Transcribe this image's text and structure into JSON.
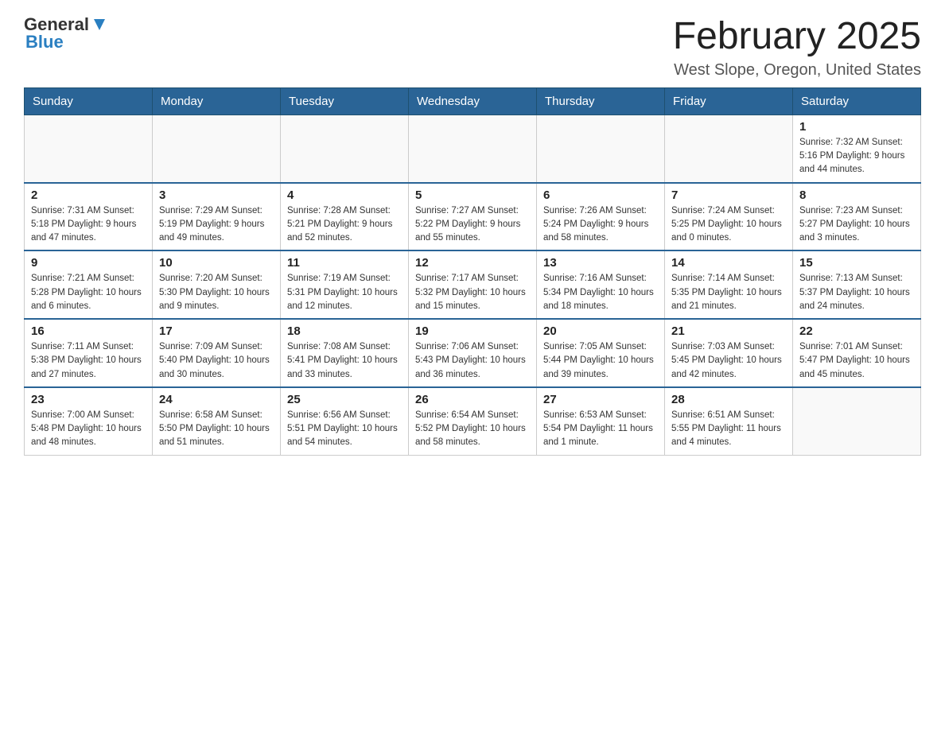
{
  "logo": {
    "general": "General",
    "blue": "Blue"
  },
  "title": "February 2025",
  "location": "West Slope, Oregon, United States",
  "days_of_week": [
    "Sunday",
    "Monday",
    "Tuesday",
    "Wednesday",
    "Thursday",
    "Friday",
    "Saturday"
  ],
  "weeks": [
    [
      {
        "day": "",
        "info": ""
      },
      {
        "day": "",
        "info": ""
      },
      {
        "day": "",
        "info": ""
      },
      {
        "day": "",
        "info": ""
      },
      {
        "day": "",
        "info": ""
      },
      {
        "day": "",
        "info": ""
      },
      {
        "day": "1",
        "info": "Sunrise: 7:32 AM\nSunset: 5:16 PM\nDaylight: 9 hours and 44 minutes."
      }
    ],
    [
      {
        "day": "2",
        "info": "Sunrise: 7:31 AM\nSunset: 5:18 PM\nDaylight: 9 hours and 47 minutes."
      },
      {
        "day": "3",
        "info": "Sunrise: 7:29 AM\nSunset: 5:19 PM\nDaylight: 9 hours and 49 minutes."
      },
      {
        "day": "4",
        "info": "Sunrise: 7:28 AM\nSunset: 5:21 PM\nDaylight: 9 hours and 52 minutes."
      },
      {
        "day": "5",
        "info": "Sunrise: 7:27 AM\nSunset: 5:22 PM\nDaylight: 9 hours and 55 minutes."
      },
      {
        "day": "6",
        "info": "Sunrise: 7:26 AM\nSunset: 5:24 PM\nDaylight: 9 hours and 58 minutes."
      },
      {
        "day": "7",
        "info": "Sunrise: 7:24 AM\nSunset: 5:25 PM\nDaylight: 10 hours and 0 minutes."
      },
      {
        "day": "8",
        "info": "Sunrise: 7:23 AM\nSunset: 5:27 PM\nDaylight: 10 hours and 3 minutes."
      }
    ],
    [
      {
        "day": "9",
        "info": "Sunrise: 7:21 AM\nSunset: 5:28 PM\nDaylight: 10 hours and 6 minutes."
      },
      {
        "day": "10",
        "info": "Sunrise: 7:20 AM\nSunset: 5:30 PM\nDaylight: 10 hours and 9 minutes."
      },
      {
        "day": "11",
        "info": "Sunrise: 7:19 AM\nSunset: 5:31 PM\nDaylight: 10 hours and 12 minutes."
      },
      {
        "day": "12",
        "info": "Sunrise: 7:17 AM\nSunset: 5:32 PM\nDaylight: 10 hours and 15 minutes."
      },
      {
        "day": "13",
        "info": "Sunrise: 7:16 AM\nSunset: 5:34 PM\nDaylight: 10 hours and 18 minutes."
      },
      {
        "day": "14",
        "info": "Sunrise: 7:14 AM\nSunset: 5:35 PM\nDaylight: 10 hours and 21 minutes."
      },
      {
        "day": "15",
        "info": "Sunrise: 7:13 AM\nSunset: 5:37 PM\nDaylight: 10 hours and 24 minutes."
      }
    ],
    [
      {
        "day": "16",
        "info": "Sunrise: 7:11 AM\nSunset: 5:38 PM\nDaylight: 10 hours and 27 minutes."
      },
      {
        "day": "17",
        "info": "Sunrise: 7:09 AM\nSunset: 5:40 PM\nDaylight: 10 hours and 30 minutes."
      },
      {
        "day": "18",
        "info": "Sunrise: 7:08 AM\nSunset: 5:41 PM\nDaylight: 10 hours and 33 minutes."
      },
      {
        "day": "19",
        "info": "Sunrise: 7:06 AM\nSunset: 5:43 PM\nDaylight: 10 hours and 36 minutes."
      },
      {
        "day": "20",
        "info": "Sunrise: 7:05 AM\nSunset: 5:44 PM\nDaylight: 10 hours and 39 minutes."
      },
      {
        "day": "21",
        "info": "Sunrise: 7:03 AM\nSunset: 5:45 PM\nDaylight: 10 hours and 42 minutes."
      },
      {
        "day": "22",
        "info": "Sunrise: 7:01 AM\nSunset: 5:47 PM\nDaylight: 10 hours and 45 minutes."
      }
    ],
    [
      {
        "day": "23",
        "info": "Sunrise: 7:00 AM\nSunset: 5:48 PM\nDaylight: 10 hours and 48 minutes."
      },
      {
        "day": "24",
        "info": "Sunrise: 6:58 AM\nSunset: 5:50 PM\nDaylight: 10 hours and 51 minutes."
      },
      {
        "day": "25",
        "info": "Sunrise: 6:56 AM\nSunset: 5:51 PM\nDaylight: 10 hours and 54 minutes."
      },
      {
        "day": "26",
        "info": "Sunrise: 6:54 AM\nSunset: 5:52 PM\nDaylight: 10 hours and 58 minutes."
      },
      {
        "day": "27",
        "info": "Sunrise: 6:53 AM\nSunset: 5:54 PM\nDaylight: 11 hours and 1 minute."
      },
      {
        "day": "28",
        "info": "Sunrise: 6:51 AM\nSunset: 5:55 PM\nDaylight: 11 hours and 4 minutes."
      },
      {
        "day": "",
        "info": ""
      }
    ]
  ]
}
